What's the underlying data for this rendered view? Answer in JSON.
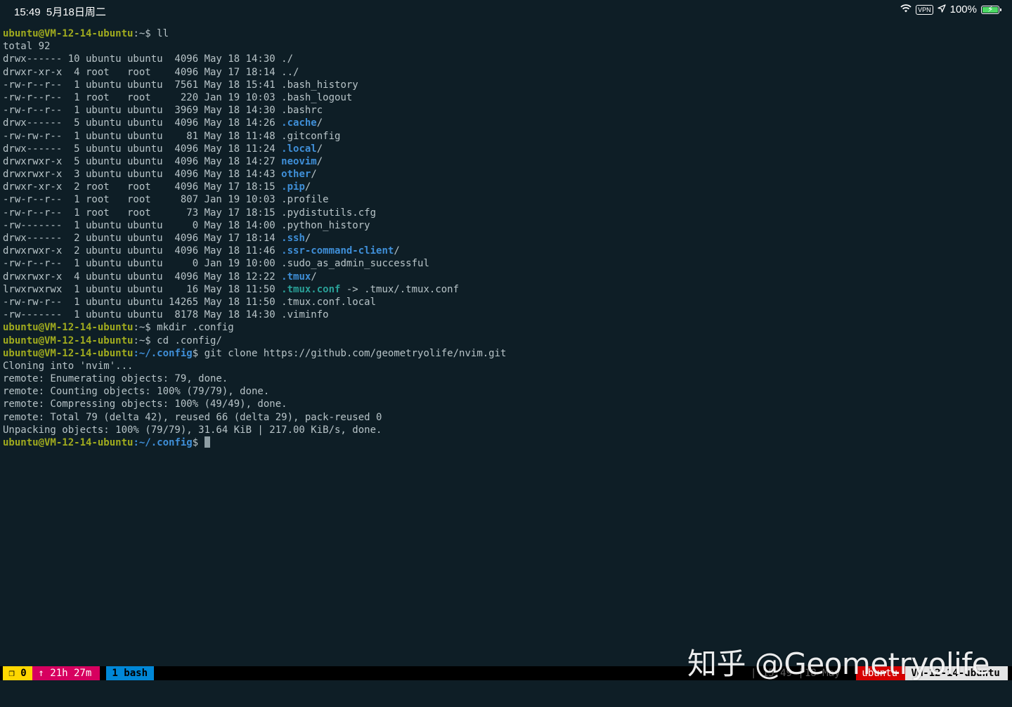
{
  "status_bar": {
    "time_date": "15:49  5月18日周二",
    "vpn": "VPN",
    "battery_text": "100%",
    "battery_level": 1.0,
    "battery_color": "#4cd964"
  },
  "terminal": {
    "colors": {
      "background": "#0e1e26",
      "foreground": "#b8c4c8",
      "prompt_user": "#a0ab1e",
      "prompt_path": "#3f8fd8",
      "directory": "#3f8fd8",
      "symlink": "#2aa198"
    },
    "prompt_user": "ubuntu@VM-12-14-ubuntu",
    "prompt_home": ":~$ ",
    "prompt_config_path": ":~/.config",
    "prompt_dollar": "$ ",
    "cmd_ll": "ll",
    "total_line": "total 92",
    "listing": [
      {
        "meta": "drwx------ 10 ubuntu ubuntu  4096 May 18 14:30 ",
        "name": "./",
        "kind": "plain"
      },
      {
        "meta": "drwxr-xr-x  4 root   root    4096 May 17 18:14 ",
        "name": "../",
        "kind": "plain"
      },
      {
        "meta": "-rw-r--r--  1 ubuntu ubuntu  7561 May 18 15:41 ",
        "name": ".bash_history",
        "kind": "plain"
      },
      {
        "meta": "-rw-r--r--  1 root   root     220 Jan 19 10:03 ",
        "name": ".bash_logout",
        "kind": "plain"
      },
      {
        "meta": "-rw-r--r--  1 ubuntu ubuntu  3969 May 18 14:30 ",
        "name": ".bashrc",
        "kind": "plain"
      },
      {
        "meta": "drwx------  5 ubuntu ubuntu  4096 May 18 14:26 ",
        "name": ".cache",
        "suffix": "/",
        "kind": "dir"
      },
      {
        "meta": "-rw-rw-r--  1 ubuntu ubuntu    81 May 18 11:48 ",
        "name": ".gitconfig",
        "kind": "plain"
      },
      {
        "meta": "drwx------  5 ubuntu ubuntu  4096 May 18 11:24 ",
        "name": ".local",
        "suffix": "/",
        "kind": "dir"
      },
      {
        "meta": "drwxrwxr-x  5 ubuntu ubuntu  4096 May 18 14:27 ",
        "name": "neovim",
        "suffix": "/",
        "kind": "dir"
      },
      {
        "meta": "drwxrwxr-x  3 ubuntu ubuntu  4096 May 18 14:43 ",
        "name": "other",
        "suffix": "/",
        "kind": "dir"
      },
      {
        "meta": "drwxr-xr-x  2 root   root    4096 May 17 18:15 ",
        "name": ".pip",
        "suffix": "/",
        "kind": "dir"
      },
      {
        "meta": "-rw-r--r--  1 root   root     807 Jan 19 10:03 ",
        "name": ".profile",
        "kind": "plain"
      },
      {
        "meta": "-rw-r--r--  1 root   root      73 May 17 18:15 ",
        "name": ".pydistutils.cfg",
        "kind": "plain"
      },
      {
        "meta": "-rw-------  1 ubuntu ubuntu     0 May 18 14:00 ",
        "name": ".python_history",
        "kind": "plain"
      },
      {
        "meta": "drwx------  2 ubuntu ubuntu  4096 May 17 18:14 ",
        "name": ".ssh",
        "suffix": "/",
        "kind": "dir"
      },
      {
        "meta": "drwxrwxr-x  2 ubuntu ubuntu  4096 May 18 11:46 ",
        "name": ".ssr-command-client",
        "suffix": "/",
        "kind": "dir"
      },
      {
        "meta": "-rw-r--r--  1 ubuntu ubuntu     0 Jan 19 10:00 ",
        "name": ".sudo_as_admin_successful",
        "kind": "plain"
      },
      {
        "meta": "drwxrwxr-x  4 ubuntu ubuntu  4096 May 18 12:22 ",
        "name": ".tmux",
        "suffix": "/",
        "kind": "dir"
      },
      {
        "meta": "lrwxrwxrwx  1 ubuntu ubuntu    16 May 18 11:50 ",
        "name": ".tmux.conf",
        "suffix": " -> .tmux/.tmux.conf",
        "kind": "link"
      },
      {
        "meta": "-rw-rw-r--  1 ubuntu ubuntu 14265 May 18 11:50 ",
        "name": ".tmux.conf.local",
        "kind": "plain"
      },
      {
        "meta": "-rw-------  1 ubuntu ubuntu  8178 May 18 14:30 ",
        "name": ".viminfo",
        "kind": "plain"
      }
    ],
    "cmd_mkdir": "mkdir .config",
    "cmd_cd": "cd .config/",
    "cmd_git": "git clone https://github.com/geometryolife/nvim.git",
    "output": [
      "Cloning into 'nvim'...",
      "remote: Enumerating objects: 79, done.",
      "remote: Counting objects: 100% (79/79), done.",
      "remote: Compressing objects: 100% (49/49), done.",
      "remote: Total 79 (delta 42), reused 66 (delta 29), pack-reused 0",
      "Unpacking objects: 100% (79/79), 31.64 KiB | 217.00 KiB/s, done."
    ]
  },
  "tmux": {
    "session": " ❐ 0 ",
    "uptime": " ↑ 21h 27m ",
    "window": " 1 bash ",
    "time": "| 15:49 |",
    "date": "18 May ",
    "user": " ubuntu ",
    "host": " VM-12-14-ubuntu "
  },
  "watermark": "知乎 @Geometryolife"
}
